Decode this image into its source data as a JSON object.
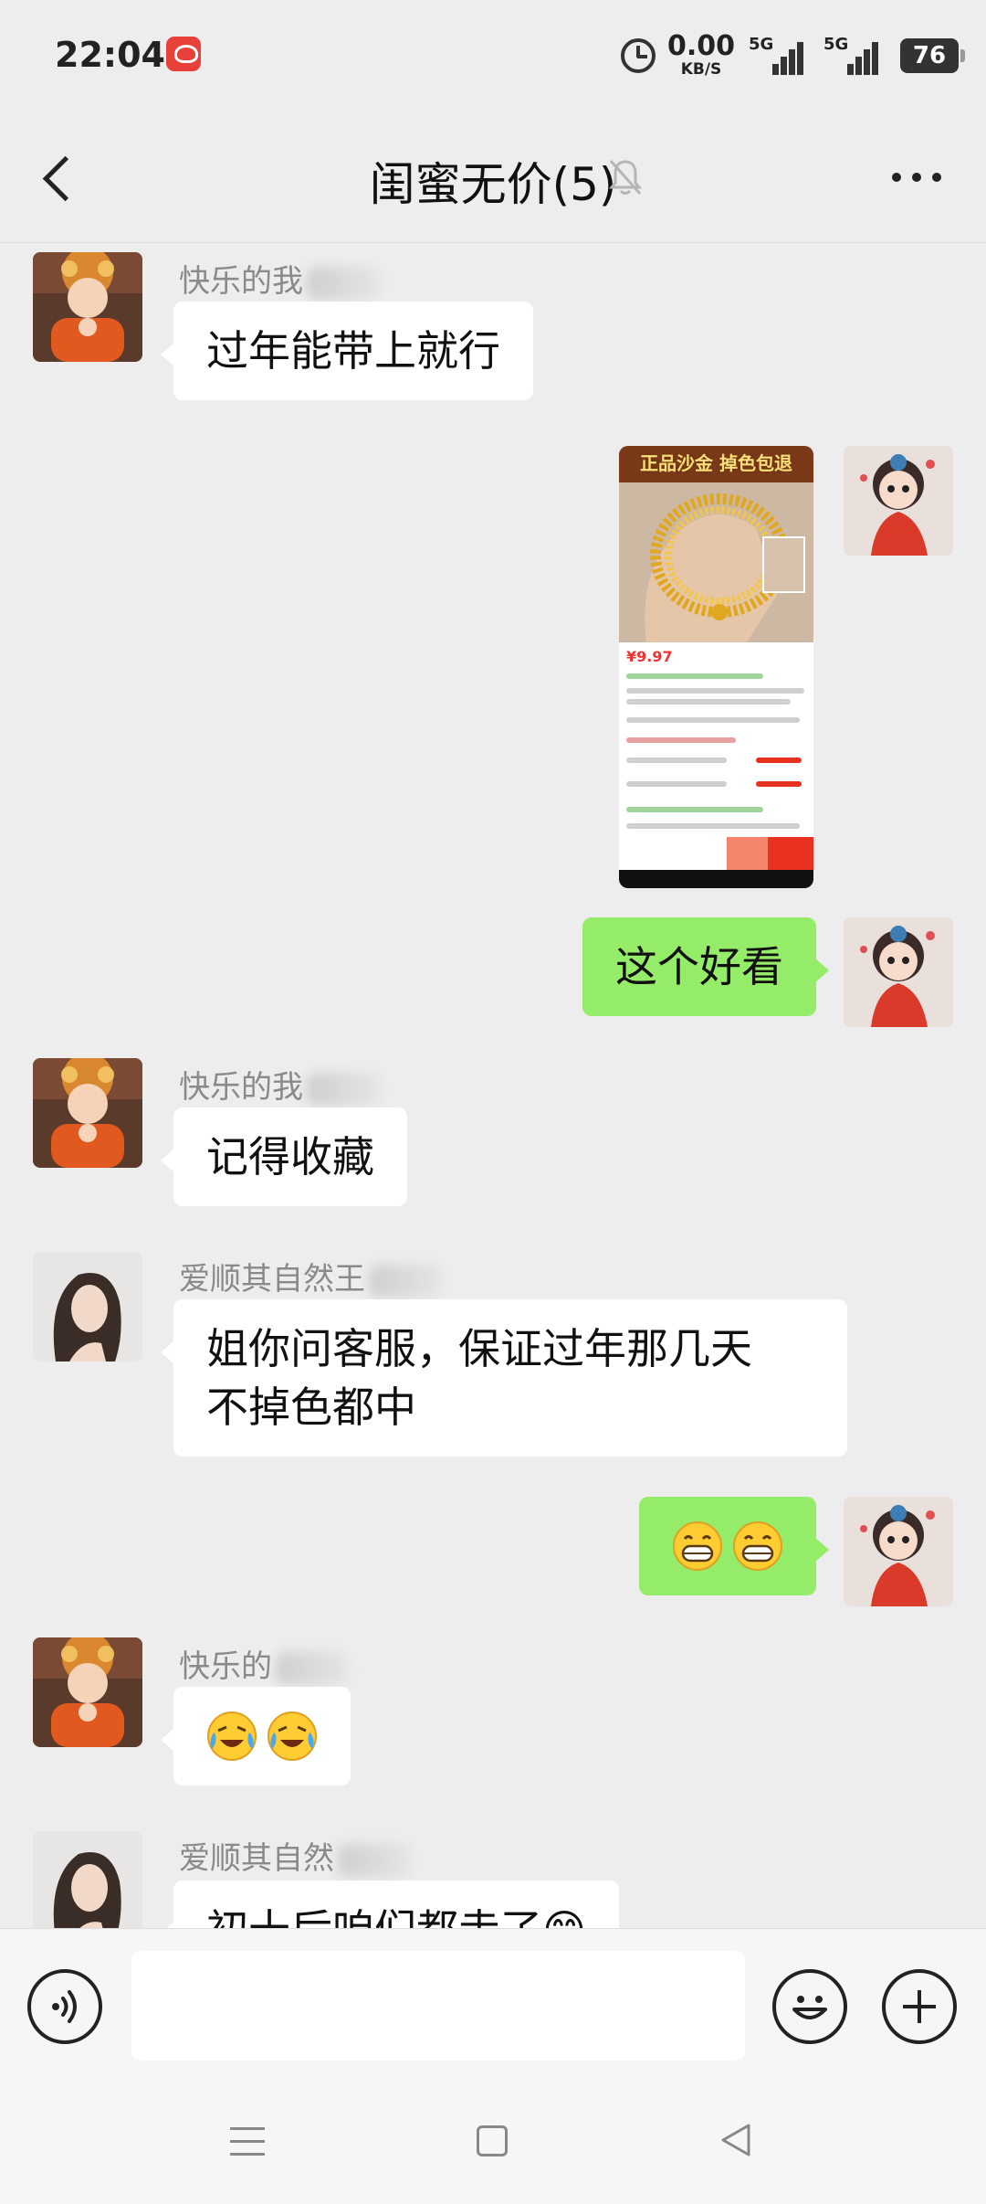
{
  "status_bar": {
    "time": "22:04",
    "app_icon": "pinduoduo-notification-icon",
    "alarm_icon": "alarm-clock-icon",
    "net_speed_value": "0.00",
    "net_speed_unit": "KB/S",
    "signal1_label": "5G",
    "signal2_label": "5G",
    "battery": "76"
  },
  "header": {
    "title": "闺蜜无价(5)",
    "back_icon": "chevron-left-icon",
    "mute_icon": "bell-muted-icon",
    "more_icon": "more-dots-icon"
  },
  "messages": [
    {
      "side": "in",
      "sender": "快乐的我",
      "text": "过年能带上就行"
    },
    {
      "side": "out",
      "type": "image",
      "banner": "正品沙金 掉色包退",
      "price": "¥9.97"
    },
    {
      "side": "out",
      "text": "这个好看"
    },
    {
      "side": "in",
      "sender": "快乐的我",
      "text": "记得收藏"
    },
    {
      "side": "in",
      "sender": "爱顺其自然王",
      "text_line1": "姐你问客服，保证过年那几天",
      "text_line2": "不掉色都中"
    },
    {
      "side": "out",
      "emoji": [
        "😁",
        "😁"
      ]
    },
    {
      "side": "in",
      "sender": "快乐的",
      "emoji": [
        "😭",
        "😭"
      ]
    },
    {
      "side": "in",
      "sender": "爱顺其自然",
      "text": "初十后咱们都走了😁"
    }
  ],
  "input_bar": {
    "voice_icon": "voice-input-icon",
    "placeholder": "",
    "emoji_icon": "emoji-face-icon",
    "plus_icon": "plus-circle-icon"
  },
  "nav_bar": {
    "menu_icon": "menu-lines-icon",
    "home_icon": "home-square-icon",
    "back_icon": "back-triangle-icon"
  },
  "colors": {
    "background": "#ededed",
    "bubble_out": "#95ec69",
    "bubble_in": "#ffffff",
    "name_gray": "#8a8a8a"
  }
}
